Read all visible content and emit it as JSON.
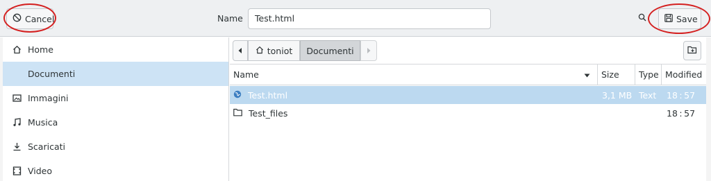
{
  "header": {
    "cancel_label": "Cancel",
    "name_label": "Name",
    "filename_value": "Test.html",
    "save_label": "Save"
  },
  "sidebar": {
    "items": [
      {
        "label": "Home",
        "icon": "home-icon"
      },
      {
        "label": "Documenti",
        "icon": "",
        "selected": true
      },
      {
        "label": "Immagini",
        "icon": "image-icon"
      },
      {
        "label": "Musica",
        "icon": "music-icon"
      },
      {
        "label": "Scaricati",
        "icon": "download-icon"
      },
      {
        "label": "Video",
        "icon": "video-icon"
      }
    ]
  },
  "pathbar": {
    "crumbs": [
      "toniot",
      "Documenti"
    ]
  },
  "filelist": {
    "columns": [
      "Name",
      "Size",
      "Type",
      "Modified"
    ],
    "rows": [
      {
        "name": "Test.html",
        "size": "3,1 MB",
        "type": "Text",
        "modified": "18 : 57",
        "icon": "web-file-icon",
        "selected": true
      },
      {
        "name": "Test_files",
        "size": "",
        "type": "",
        "modified": "18 : 57",
        "icon": "folder-icon",
        "selected": false
      }
    ]
  },
  "colors": {
    "selection_sidebar": "#cde3f5",
    "selection_row": "#bcd9f0",
    "annotation_red": "#d42020"
  }
}
